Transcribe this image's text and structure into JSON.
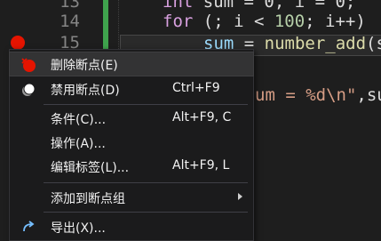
{
  "editor": {
    "line_numbers": [
      "13",
      "14",
      "15"
    ],
    "code": {
      "line13_kw": "int",
      "line13_rest": " sum = 0, i = 0;",
      "line14_kw": "for",
      "line14_a": " (; i < ",
      "line14_num": "100",
      "line14_b": "; i++)",
      "line15_a": "sum",
      "line15_b": " = ",
      "line15_fn": "number_add",
      "line15_c": "(s",
      "line17_str": "um = %d\\n\"",
      "line17_rest": ",su"
    },
    "colors": {
      "breakpoint": "#e51400",
      "change_bar": "#3fa34d",
      "keyword": "#d8a0df",
      "function": "#dcdcaa",
      "string": "#d69d85"
    }
  },
  "context_menu": {
    "items": [
      {
        "label": "删除断点(E)",
        "shortcut": "",
        "icon": "breakpoint-delete-icon"
      },
      {
        "label": "禁用断点(D)",
        "shortcut": "Ctrl+F9",
        "icon": "breakpoint-disable-icon"
      },
      {
        "label": "条件(C)...",
        "shortcut": "Alt+F9, C"
      },
      {
        "label": "操作(A)...",
        "shortcut": ""
      },
      {
        "label": "编辑标签(L)...",
        "shortcut": "Alt+F9, L"
      },
      {
        "label": "添加到断点组",
        "shortcut": "",
        "submenu": true
      },
      {
        "label": "导出(X)...",
        "shortcut": "",
        "icon": "export-icon"
      }
    ]
  }
}
